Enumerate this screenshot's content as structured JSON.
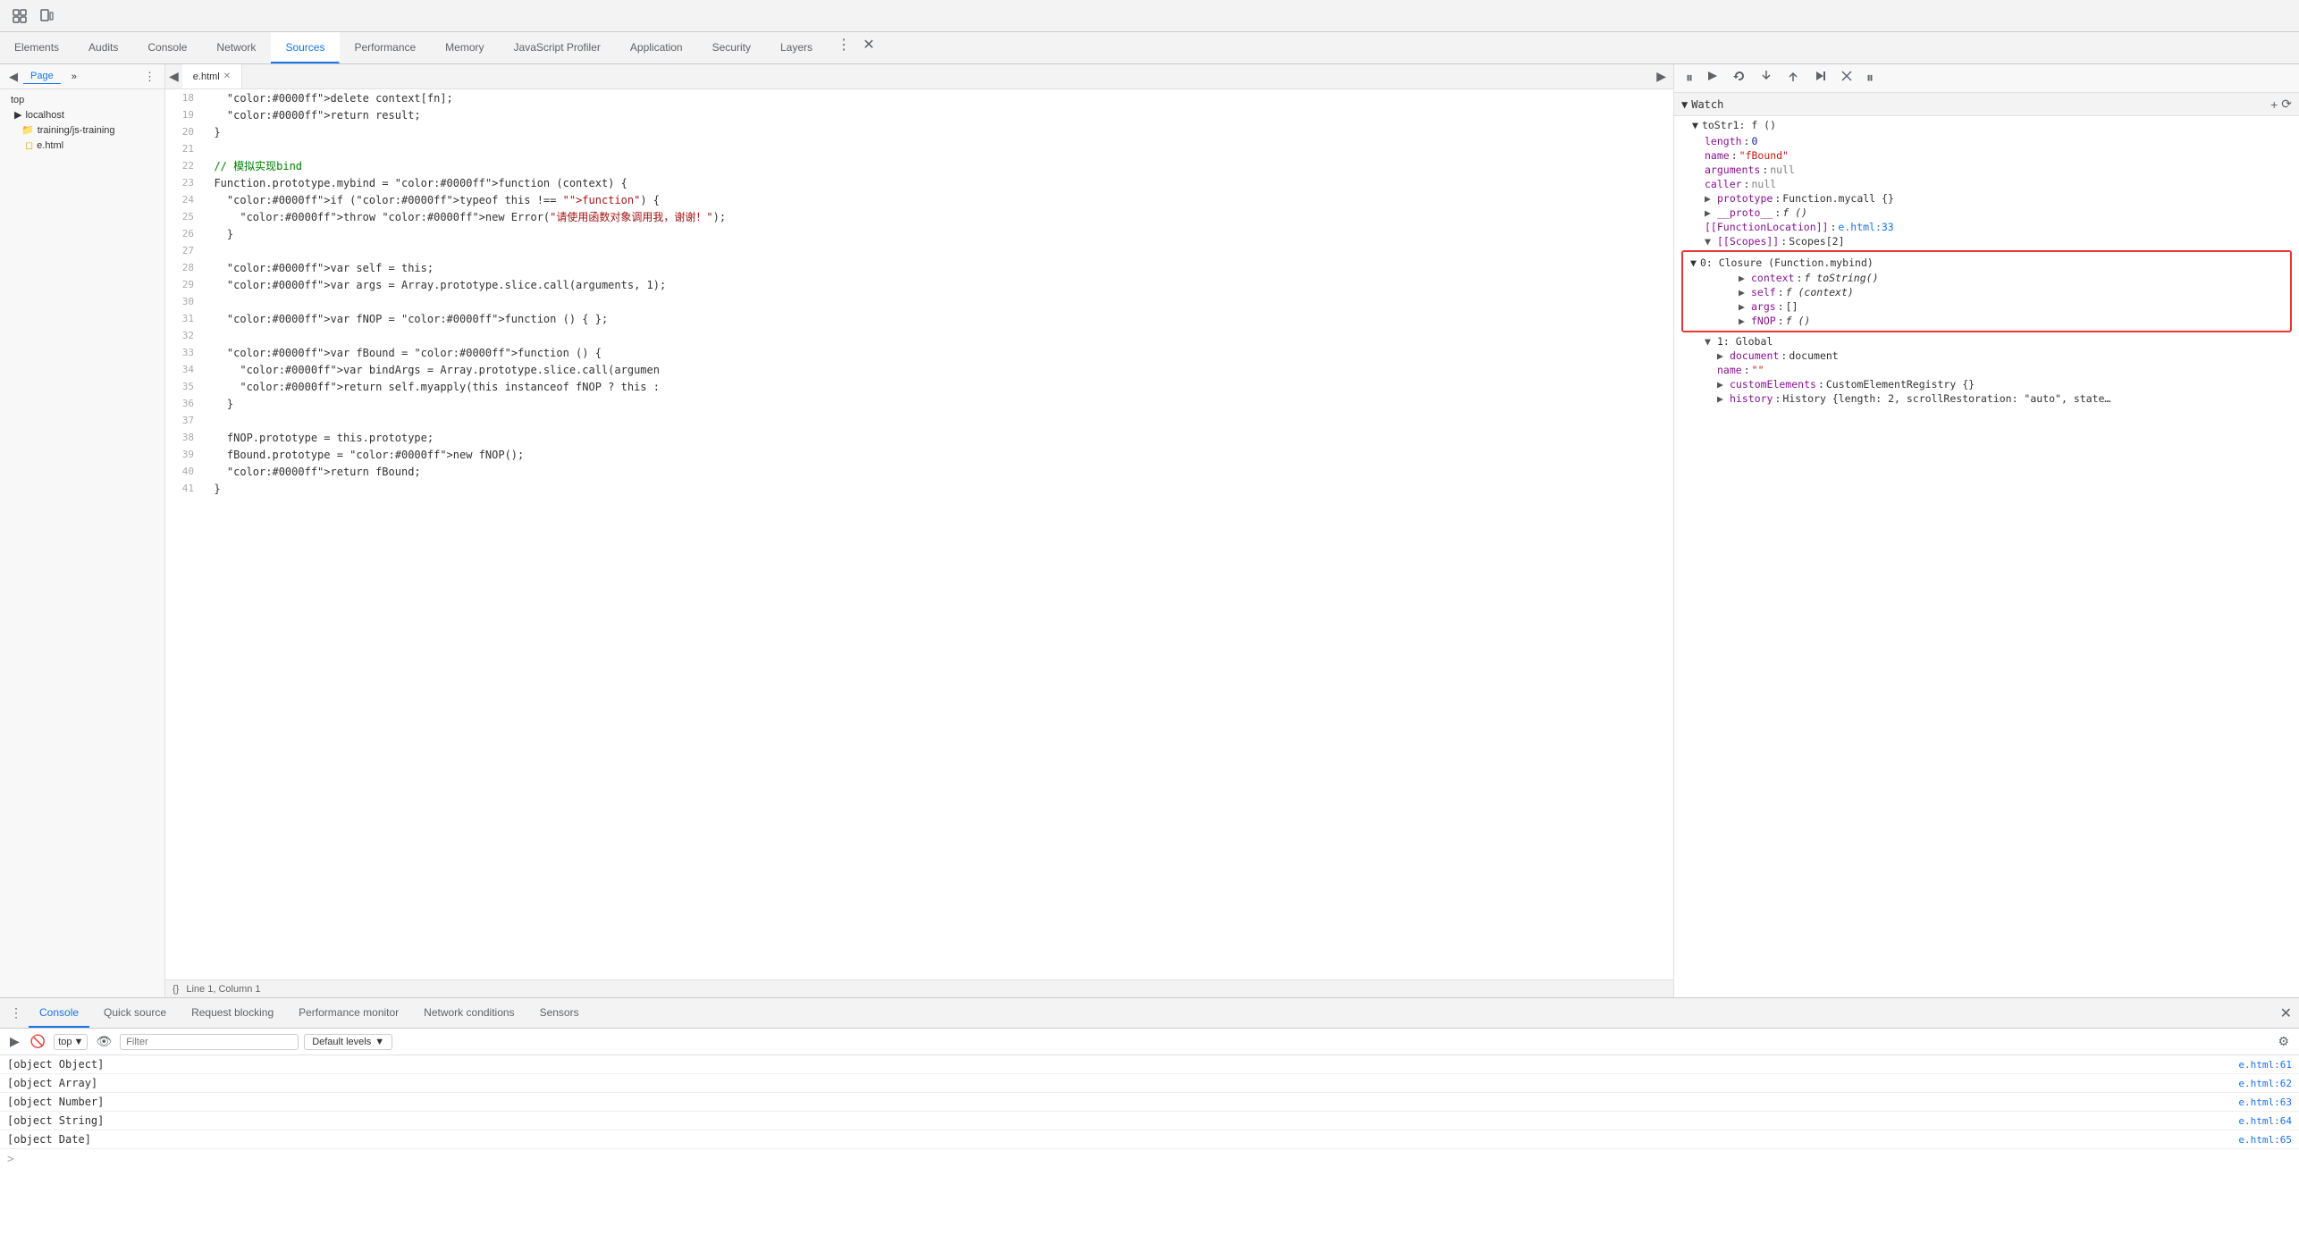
{
  "tabs": [
    {
      "label": "Elements",
      "active": false
    },
    {
      "label": "Audits",
      "active": false
    },
    {
      "label": "Console",
      "active": false
    },
    {
      "label": "Network",
      "active": false
    },
    {
      "label": "Sources",
      "active": true
    },
    {
      "label": "Performance",
      "active": false
    },
    {
      "label": "Memory",
      "active": false
    },
    {
      "label": "JavaScript Profiler",
      "active": false
    },
    {
      "label": "Application",
      "active": false
    },
    {
      "label": "Security",
      "active": false
    },
    {
      "label": "Layers",
      "active": false
    }
  ],
  "toolbar": {
    "icons": [
      "◀",
      "⠿",
      "⋮"
    ]
  },
  "sidebar": {
    "tab_page": "Page",
    "items": [
      {
        "label": "top",
        "indent": 0,
        "type": "text"
      },
      {
        "label": "localhost",
        "indent": 1,
        "type": "folder"
      },
      {
        "label": "training/js-training",
        "indent": 2,
        "type": "folder"
      },
      {
        "label": "e.html",
        "indent": 3,
        "type": "file"
      }
    ]
  },
  "editor": {
    "filename": "e.html",
    "lines": [
      {
        "num": 18,
        "code": "    delete context[fn];"
      },
      {
        "num": 19,
        "code": "    return result;"
      },
      {
        "num": 20,
        "code": "  }"
      },
      {
        "num": 21,
        "code": ""
      },
      {
        "num": 22,
        "code": "  // 模拟实现bind",
        "comment": true
      },
      {
        "num": 23,
        "code": "  Function.prototype.mybind = function (context) {"
      },
      {
        "num": 24,
        "code": "    if (typeof this !== \"function\") {"
      },
      {
        "num": 25,
        "code": "      throw new Error(\"请使用函数对象调用我，谢谢！\");"
      },
      {
        "num": 26,
        "code": "    }"
      },
      {
        "num": 27,
        "code": ""
      },
      {
        "num": 28,
        "code": "    var self = this;"
      },
      {
        "num": 29,
        "code": "    var args = Array.prototype.slice.call(arguments, 1);"
      },
      {
        "num": 30,
        "code": ""
      },
      {
        "num": 31,
        "code": "    var fNOP = function () { };"
      },
      {
        "num": 32,
        "code": ""
      },
      {
        "num": 33,
        "code": "    var fBound = function () {"
      },
      {
        "num": 34,
        "code": "      var bindArgs = Array.prototype.slice.call(argumen"
      },
      {
        "num": 35,
        "code": "      return self.myapply(this instanceof fNOP ? this :"
      },
      {
        "num": 36,
        "code": "    }"
      },
      {
        "num": 37,
        "code": ""
      },
      {
        "num": 38,
        "code": "    fNOP.prototype = this.prototype;"
      },
      {
        "num": 39,
        "code": "    fBound.prototype = new fNOP();"
      },
      {
        "num": 40,
        "code": "    return fBound;"
      },
      {
        "num": 41,
        "code": "  }"
      }
    ],
    "status": "Line 1, Column 1"
  },
  "watch": {
    "title": "Watch",
    "add_btn": "+",
    "refresh_btn": "⟳",
    "section_label": "toStr1: f ()",
    "props": [
      {
        "key": "length",
        "value": "0",
        "type": "num",
        "indent": 2
      },
      {
        "key": "name",
        "value": "\"fBound\"",
        "type": "str",
        "indent": 2
      },
      {
        "key": "arguments",
        "value": "null",
        "type": "null",
        "indent": 2
      },
      {
        "key": "caller",
        "value": "null",
        "type": "null",
        "indent": 2
      },
      {
        "key": "prototype",
        "value": "Function.mycall {}",
        "type": "obj",
        "indent": 2,
        "expandable": true
      },
      {
        "key": "__proto__",
        "value": "f ()",
        "type": "fn",
        "indent": 2,
        "expandable": true
      },
      {
        "key": "[[FunctionLocation]]",
        "value": "e.html:33",
        "type": "link",
        "indent": 2
      },
      {
        "key": "[[Scopes]]",
        "value": "Scopes[2]",
        "type": "obj",
        "indent": 2,
        "expandable": true,
        "expanded": true
      }
    ],
    "scopes": {
      "title": "[[Scopes]]: Scopes[2]",
      "closure": {
        "title": "0: Closure (Function.mybind)",
        "items": [
          {
            "key": "context",
            "value": "f toString()",
            "type": "fn",
            "expandable": true
          },
          {
            "key": "self",
            "value": "f (context)",
            "type": "fn",
            "expandable": true
          },
          {
            "key": "args",
            "value": "[]",
            "type": "obj",
            "expandable": true
          },
          {
            "key": "fNOP",
            "value": "f ()",
            "type": "fn",
            "expandable": true
          }
        ]
      },
      "global": {
        "title": "1: Global",
        "items": [
          {
            "key": "document",
            "value": "document",
            "type": "obj",
            "expandable": true
          },
          {
            "key": "name",
            "value": "\"\"",
            "type": "str"
          },
          {
            "key": "customElements",
            "value": "CustomElementRegistry {}",
            "type": "obj",
            "expandable": true
          },
          {
            "key": "history",
            "value": "History {length: 2, scrollRestoration: \"auto\", state",
            "type": "obj",
            "expandable": true
          }
        ]
      }
    }
  },
  "bottom": {
    "tabs": [
      "Console",
      "Quick source",
      "Request blocking",
      "Performance monitor",
      "Network conditions",
      "Sensors"
    ],
    "active_tab": "Console",
    "filter_placeholder": "Filter",
    "levels_label": "Default levels",
    "console_rows": [
      {
        "text": "[object Object]",
        "link": "e.html:61"
      },
      {
        "text": "[object Array]",
        "link": "e.html:62"
      },
      {
        "text": "[object Number]",
        "link": "e.html:63"
      },
      {
        "text": "[object String]",
        "link": "e.html:64"
      },
      {
        "text": "[object Date]",
        "link": "e.html:65"
      }
    ]
  },
  "icons": {
    "pause": "⏸",
    "resume": "▶",
    "step_over": "↷",
    "step_into": "↓",
    "step_out": "↑",
    "step_forward": "→",
    "deactivate": "⊘",
    "breakpoints": "⏸",
    "close": "✕",
    "back": "◀",
    "collapse": "▶",
    "expand": "▼",
    "triangle_right": "▶",
    "triangle_down": "▼",
    "ellipsis": "⋮",
    "more": "»",
    "run": "▶",
    "eye": "👁",
    "block": "🚫",
    "settings": "⚙"
  }
}
